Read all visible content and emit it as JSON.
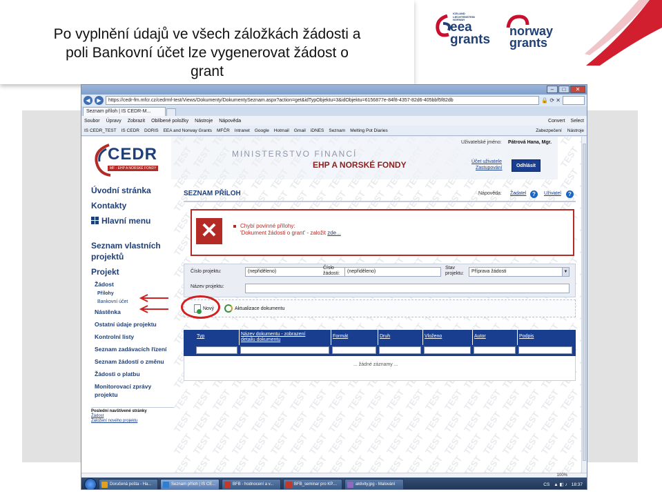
{
  "slide": {
    "title_line1": "Po vyplnění údajů ve všech záložkách žádosti a",
    "title_line2": "poli Bankovní účet lze vygenerovat žádost o",
    "title_line3": "grant",
    "logos": {
      "eea_top": "ICELAND LIECHTENSTEIN NORWAY",
      "eea_main1": "eea",
      "eea_main2": "grants",
      "norway_main1": "norway",
      "norway_main2": "grants"
    }
  },
  "browser": {
    "address": "https://cedr-fm.mfcr.cz/cedrmf-test/Views/Dokumenty/DokumentySeznam.aspx?action=get&idTypObjektu=3&idObjektu=6156877e-84f8-4357-82d6-405bbf5f82db",
    "tab_title": "Seznam příloh | IS CEDR-M...",
    "menu": [
      "Soubor",
      "Úpravy",
      "Zobrazit",
      "Oblíbené položky",
      "Nástroje",
      "Nápověda"
    ],
    "menu_right": [
      "Convert",
      "Select"
    ],
    "favorites": [
      "IS CEDR_TEST",
      "IS CEDR",
      "DORIS",
      "EEA and Norway Grants",
      "MFČR",
      "Intranet",
      "Google",
      "Hotmail",
      "Gmail",
      "iDNES",
      "Seznam",
      "Melting Pot Diaries"
    ],
    "fav_right": [
      "Zabezpečení",
      "Nástroje"
    ],
    "status_zoom": "100%"
  },
  "page": {
    "cedr_logo": "CEDR",
    "cedr_sub": "MF - EHP A NORSKÉ FONDY",
    "ministerstvo": "MINISTERSTVO FINANCÍ",
    "ehp": "EHP A NORSKÉ FONDY",
    "user_label": "Uživatelské jméno:",
    "user_name": "Pátrová Hana, Mgr.",
    "user_link1": "Účet uživatele",
    "user_link2": "Zastupování",
    "logout": "Odhlásit",
    "watermark": "TEST",
    "nav": {
      "uvodni": "Úvodní stránka",
      "kontakty": "Kontakty",
      "hlavni_menu": "Hlavní menu",
      "seznam_projektu_1": "Seznam vlastních",
      "seznam_projektu_2": "projektů",
      "projekt": "Projekt",
      "zadost": "Žádost",
      "prilohy": "Přílohy",
      "bankovni_ucet": "Bankovní účet",
      "nastenka": "Nástěnka",
      "ostatni_udaje": "Ostatní údaje projektu",
      "kontrolni_listy": "Kontrolní listy",
      "seznam_zadavacich": "Seznam zadávacích řízení",
      "seznam_zadosti_zmenu": "Seznam žádostí o změnu",
      "zadosti_platbu": "Žádosti o platbu",
      "monitorovaci_1": "Monitorovací zprávy",
      "monitorovaci_2": "projektu",
      "posledni": "Poslední navštívené stránky",
      "posledni_link1": "Žádost",
      "posledni_link2": "Založení nového projektu"
    },
    "section_title": "SEZNAM PŘÍLOH",
    "napoveda": "Nápověda:",
    "help_zadatel": "Žadatel",
    "help_uzivatel": "Uživatel",
    "error_line1": "Chybí povinné přílohy:",
    "error_line2": "'Dokument žádosti o grant' - založit ",
    "error_link": "zde...",
    "form": {
      "cislo_projektu_label": "Číslo projektu:",
      "cislo_projektu_value": "(nepřiděleno)",
      "cislo_zadosti_label": "Číslo žádosti:",
      "cislo_zadosti_value": "(nepřiděleno)",
      "stav_projektu_label": "Stav projektu:",
      "stav_projektu_value": "Příprava žádosti",
      "nazev_projektu_label": "Název projektu:",
      "nazev_projektu_value": ""
    },
    "toolbar": {
      "novy": "Nový",
      "aktualizace": "Aktualizace dokumentu"
    },
    "table": {
      "headers": [
        "Typ",
        "Název dokumentu - zobrazení detailu dokumentu",
        "Formát",
        "Druh",
        "Vloženo",
        "Autor",
        "Podpis"
      ],
      "empty": "... žádné záznamy ..."
    }
  },
  "taskbar": {
    "items": [
      "Doručená pošta - Ha...",
      "Seznam příloh | IS CE...",
      "BFB - hodnocení a v...",
      "BFB_seminar pro KP....",
      "aktivity.jpg - Malování"
    ],
    "lang": "CS",
    "time": "18:37"
  },
  "colors": {
    "brand_blue": "#1a3e8f",
    "error_red": "#b42b25",
    "eea_red": "#c8102e"
  }
}
